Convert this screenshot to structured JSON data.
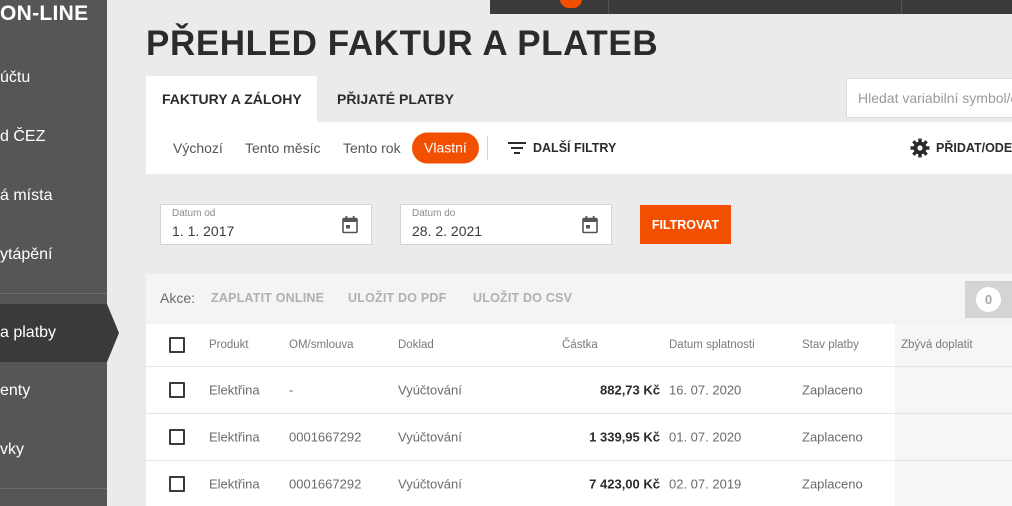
{
  "sidebar": {
    "brand": "ON-LINE",
    "items": [
      {
        "label": "účtu"
      },
      {
        "label": "d ČEZ"
      },
      {
        "label": "á místa"
      },
      {
        "label": "ytápění"
      },
      {
        "label": "a platby"
      },
      {
        "label": "enty"
      },
      {
        "label": "vky"
      }
    ]
  },
  "page": {
    "title": "PŘEHLED FAKTUR A PLATEB"
  },
  "tabs": [
    {
      "label": "FAKTURY A ZÁLOHY",
      "active": true
    },
    {
      "label": "PŘIJATÉ PLATBY",
      "active": false
    }
  ],
  "search": {
    "placeholder": "Hledat variabilní symbol/č"
  },
  "quick_filters": [
    {
      "label": "Výchozí"
    },
    {
      "label": "Tento měsíc"
    },
    {
      "label": "Tento rok"
    },
    {
      "label": "Vlastní",
      "active": true
    }
  ],
  "more_filters": {
    "label": "DALŠÍ FILTRY"
  },
  "add_remove": {
    "label": "PŘIDAT/ODE"
  },
  "date_from": {
    "label": "Datum od",
    "value": "1. 1. 2017"
  },
  "date_to": {
    "label": "Datum do",
    "value": "28. 2. 2021"
  },
  "filter_button": {
    "label": "FILTROVAT"
  },
  "actions": {
    "label": "Akce:",
    "items": [
      {
        "label": "ZAPLATIT ONLINE"
      },
      {
        "label": "ULOŽIT DO PDF"
      },
      {
        "label": "ULOŽIT DO CSV"
      }
    ],
    "selected_count": "0"
  },
  "table": {
    "columns": [
      "Produkt",
      "OM/smlouva",
      "Doklad",
      "Částka",
      "Datum splatnosti",
      "Stav platby",
      "Zbývá doplatit"
    ],
    "rows": [
      {
        "product": "Elektřina",
        "contract": "-",
        "document": "Vyúčtování",
        "amount": "882,73 Kč",
        "due_date": "16. 07. 2020",
        "status": "Zaplaceno"
      },
      {
        "product": "Elektřina",
        "contract": "0001667292",
        "document": "Vyúčtování",
        "amount": "1 339,95 Kč",
        "due_date": "01. 07. 2020",
        "status": "Zaplaceno"
      },
      {
        "product": "Elektřina",
        "contract": "0001667292",
        "document": "Vyúčtování",
        "amount": "7 423,00 Kč",
        "due_date": "02. 07. 2019",
        "status": "Zaplaceno"
      }
    ]
  },
  "colors": {
    "accent": "#f24f00",
    "sidebar": "#565656",
    "sidebar_active": "#3a3a3a"
  }
}
